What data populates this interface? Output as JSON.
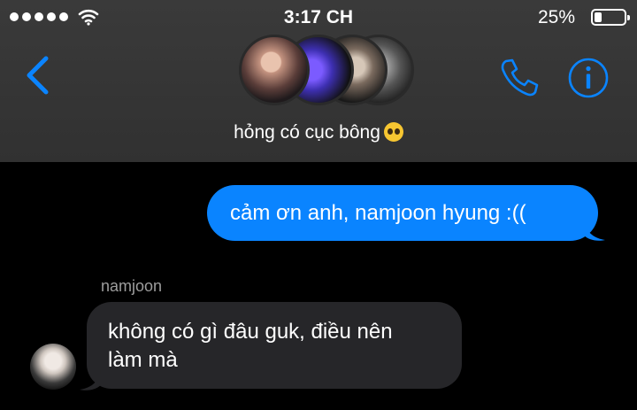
{
  "status_bar": {
    "time": "3:17 CH",
    "battery": "25%",
    "battery_level": 0.25
  },
  "header": {
    "group_name": "hỏng có cục bông",
    "group_emoji": "pleading-face-emoji",
    "icons": {
      "back": "chevron-left-icon",
      "call": "phone-icon",
      "info": "info-icon"
    },
    "accent_color": "#0a84ff"
  },
  "messages": [
    {
      "direction": "outgoing",
      "text": "cảm ơn anh, namjoon hyung :(("
    },
    {
      "direction": "incoming",
      "sender": "namjoon",
      "lines": [
        "không có gì đâu guk, điều nên",
        "làm mà"
      ]
    }
  ]
}
